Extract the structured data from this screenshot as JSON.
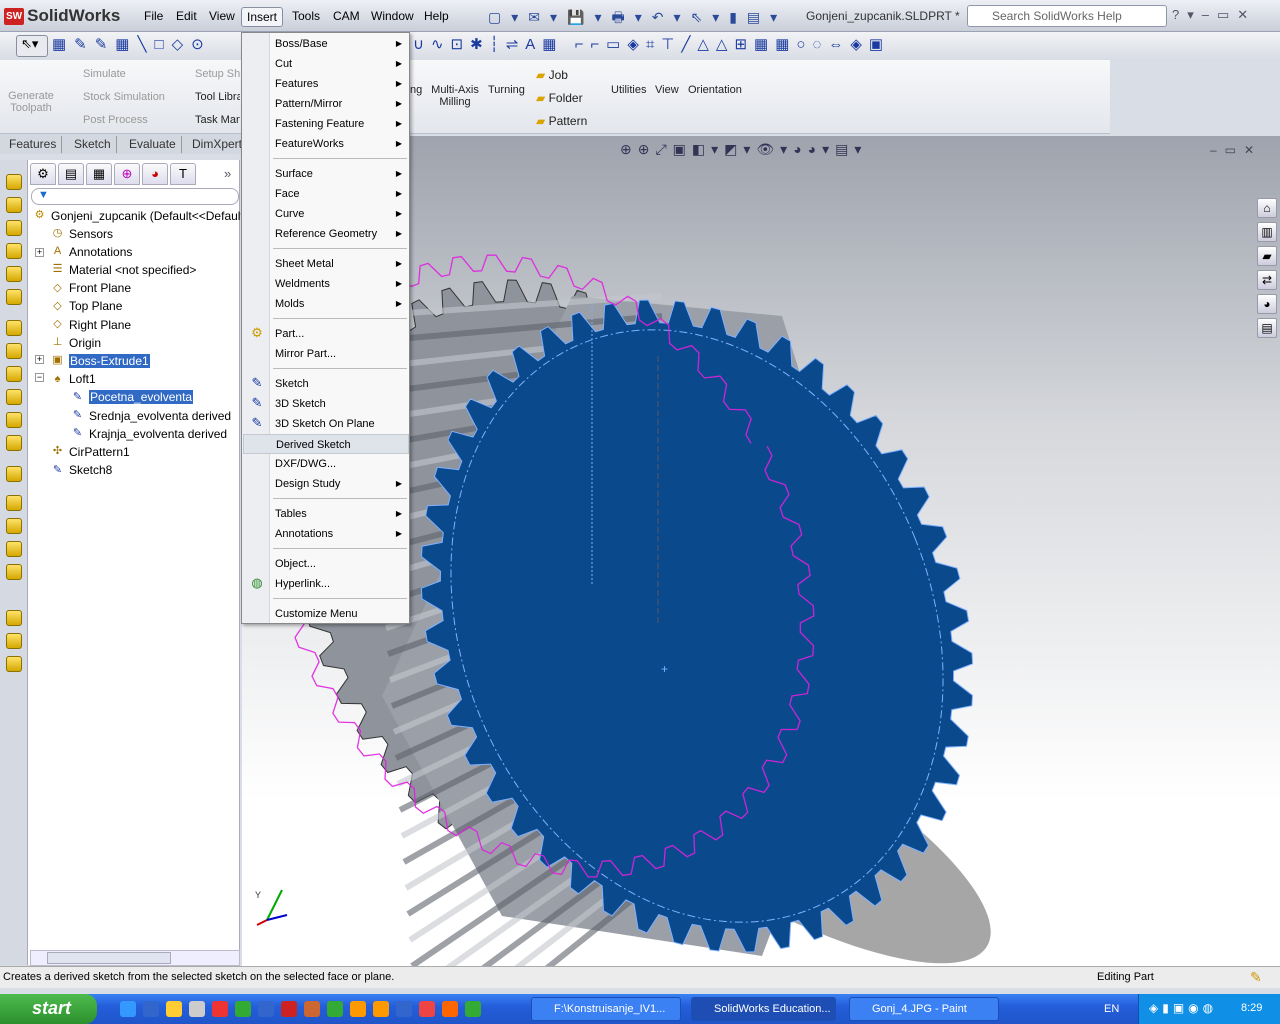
{
  "app": {
    "name": "SolidWorks",
    "document_title": "Gonjeni_zupcanik.SLDPRT *",
    "search_placeholder": "Search SolidWorks Help"
  },
  "menubar": [
    "File",
    "Edit",
    "View",
    "Insert",
    "Tools",
    "CAM",
    "Window",
    "Help"
  ],
  "menubar_active": "Insert",
  "ribbon": {
    "camworks": [
      "Generate Toolpath",
      "Simulate",
      "Stock Simulation",
      "Post Process",
      "Setup Sheet",
      "Tool Library",
      "Task Manager"
    ],
    "machining": [
      "ng",
      "Multi-Axis Milling",
      "Turning"
    ],
    "group": [
      "Job",
      "Folder",
      "Pattern"
    ],
    "other": [
      "Utilities",
      "View",
      "Orientation"
    ]
  },
  "command_tabs": [
    "Features",
    "Sketch",
    "Evaluate",
    "DimXpert"
  ],
  "feature_tree": {
    "root": "Gonjeni_zupcanik  (Default<<Default>",
    "items": [
      {
        "label": "Sensors",
        "icon": "sensor-icon"
      },
      {
        "label": "Annotations",
        "icon": "annotations-icon"
      },
      {
        "label": "Material <not specified>",
        "icon": "material-icon"
      },
      {
        "label": "Front Plane",
        "icon": "plane-icon"
      },
      {
        "label": "Top Plane",
        "icon": "plane-icon"
      },
      {
        "label": "Right Plane",
        "icon": "plane-icon"
      },
      {
        "label": "Origin",
        "icon": "origin-icon"
      },
      {
        "label": "Boss-Extrude1",
        "icon": "extrude-icon",
        "selected": true
      },
      {
        "label": "Loft1",
        "icon": "loft-icon"
      },
      {
        "label": "Pocetna_evolventa",
        "icon": "sketch-icon",
        "selected": true
      },
      {
        "label": "Srednja_evolventa derived",
        "icon": "sketch-icon"
      },
      {
        "label": "Krajnja_evolventa derived",
        "icon": "sketch-icon"
      },
      {
        "label": "CirPattern1",
        "icon": "circular-pattern-icon"
      },
      {
        "label": "Sketch8",
        "icon": "sketch-icon"
      }
    ]
  },
  "insert_menu": [
    {
      "label": "Boss/Base",
      "submenu": true
    },
    {
      "label": "Cut",
      "submenu": true
    },
    {
      "label": "Features",
      "submenu": true
    },
    {
      "label": "Pattern/Mirror",
      "submenu": true
    },
    {
      "label": "Fastening Feature",
      "submenu": true
    },
    {
      "label": "FeatureWorks",
      "submenu": true
    },
    {
      "label": "Surface",
      "submenu": true
    },
    {
      "label": "Face",
      "submenu": true
    },
    {
      "label": "Curve",
      "submenu": true
    },
    {
      "label": "Reference Geometry",
      "submenu": true
    },
    {
      "label": "Sheet Metal",
      "submenu": true
    },
    {
      "label": "Weldments",
      "submenu": true
    },
    {
      "label": "Molds",
      "submenu": true
    },
    {
      "label": "Part..."
    },
    {
      "label": "Mirror Part..."
    },
    {
      "label": "Sketch"
    },
    {
      "label": "3D Sketch"
    },
    {
      "label": "3D Sketch On Plane"
    },
    {
      "label": "Derived Sketch",
      "highlighted": true
    },
    {
      "label": "DXF/DWG..."
    },
    {
      "label": "Design Study",
      "submenu": true
    },
    {
      "label": "Tables",
      "submenu": true
    },
    {
      "label": "Annotations",
      "submenu": true
    },
    {
      "label": "Object..."
    },
    {
      "label": "Hyperlink..."
    },
    {
      "label": "Customize Menu"
    }
  ],
  "status": {
    "message": "Creates a derived sketch from the selected sketch on the selected face or plane.",
    "mode": "Editing Part"
  },
  "taskbar": {
    "start": "start",
    "tasks": [
      "F:\\Konstruisanje_IV1...",
      "SolidWorks Education...",
      "Gonj_4.JPG - Paint"
    ],
    "active_task": "SolidWorks Education...",
    "language": "EN",
    "clock": "8:29"
  },
  "colors": {
    "gear_face": "#0a4a8c",
    "gear_body": "#8e939c",
    "sketch_magenta": "#e020e0",
    "selection": "#316ac5"
  }
}
